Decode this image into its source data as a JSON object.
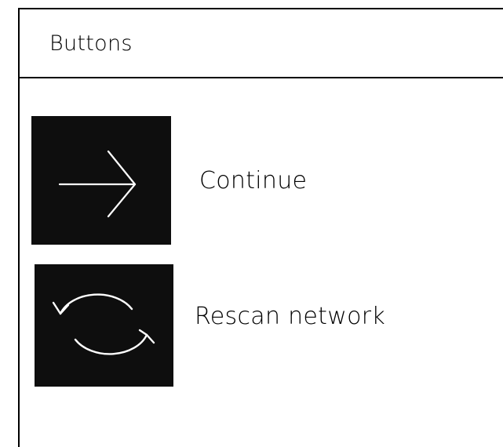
{
  "panel": {
    "title": "Buttons"
  },
  "buttons": [
    {
      "label": "Continue",
      "icon": "arrow-right-icon"
    },
    {
      "label": "Rescan network",
      "icon": "refresh-icon"
    }
  ],
  "colors": {
    "tile_background": "#0e0e0e",
    "icon_stroke": "#ffffff",
    "border": "#000000",
    "text": "#000000"
  }
}
